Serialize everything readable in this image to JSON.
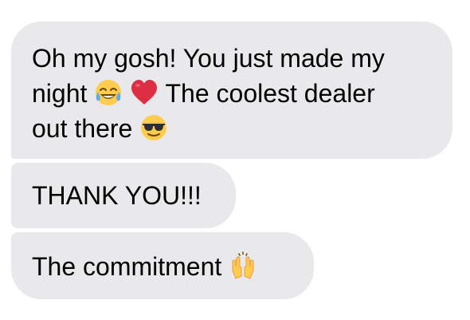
{
  "messages": [
    {
      "lines": [
        "Oh my gosh! You just made my",
        {
          "pre": "night ",
          "post": " The coolest dealer"
        },
        {
          "pre": "out there ",
          "post": ""
        }
      ],
      "icons": [
        "tears-of-joy-emoji",
        "red-heart-emoji",
        "sunglasses-emoji"
      ]
    },
    {
      "text": "THANK YOU!!!"
    },
    {
      "text": "The commitment ",
      "icons": [
        "raising-hands-emoji"
      ]
    }
  ],
  "colors": {
    "bubble_bg": "#e9e9eb",
    "text": "#000000",
    "background": "#ffffff"
  }
}
